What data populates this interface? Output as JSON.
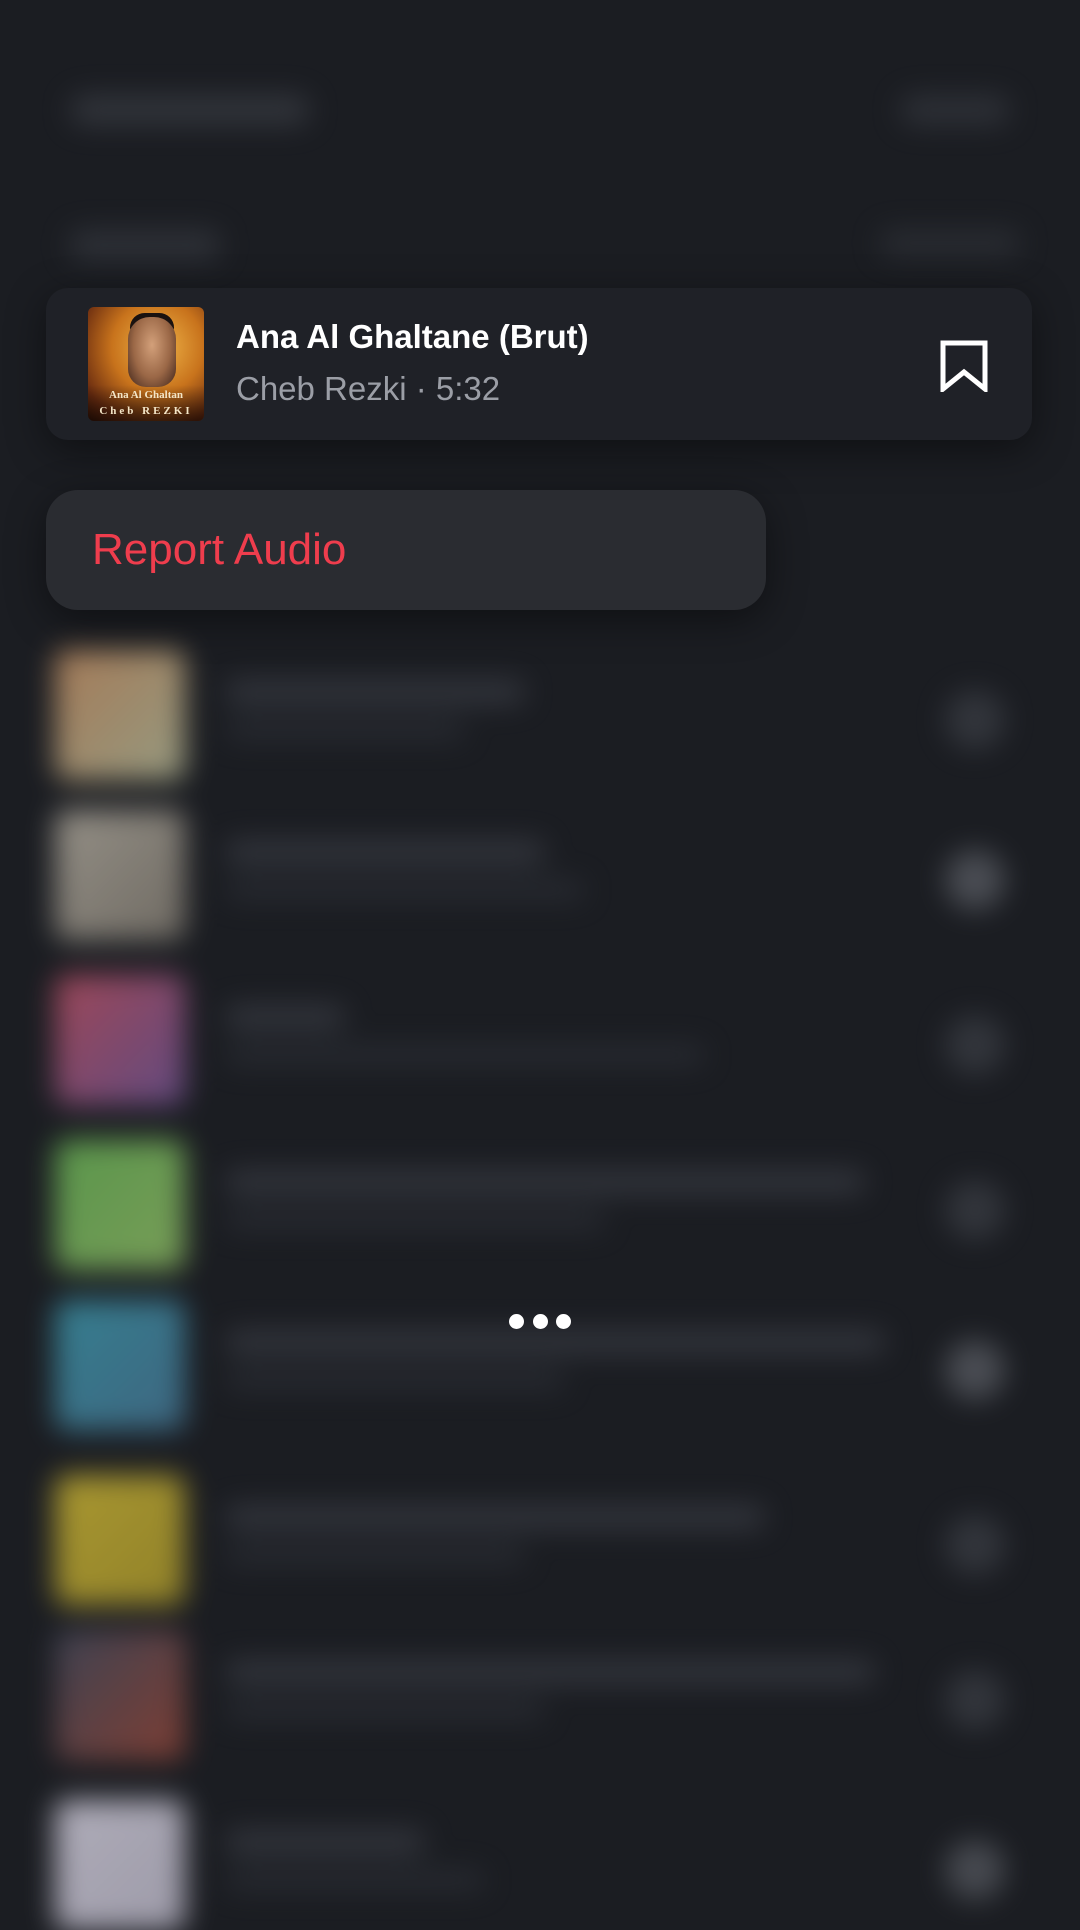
{
  "song": {
    "title": "Ana Al Ghaltane (Brut)",
    "artist": "Cheb Rezki",
    "separator": " · ",
    "duration": "5:32",
    "cover_text_line1": "Ana Al Ghaltan",
    "cover_text_line2": "Cheb REZKI"
  },
  "menu": {
    "items": [
      {
        "label": "Report Audio"
      }
    ]
  },
  "icons": {
    "save": "bookmark-icon",
    "loading": "loading-dots"
  },
  "colors": {
    "background": "#1b1d22",
    "card": "#1f2127",
    "menu": "#2a2c31",
    "destructive": "#ef3d4d",
    "secondary_text": "#9b9ea6"
  }
}
